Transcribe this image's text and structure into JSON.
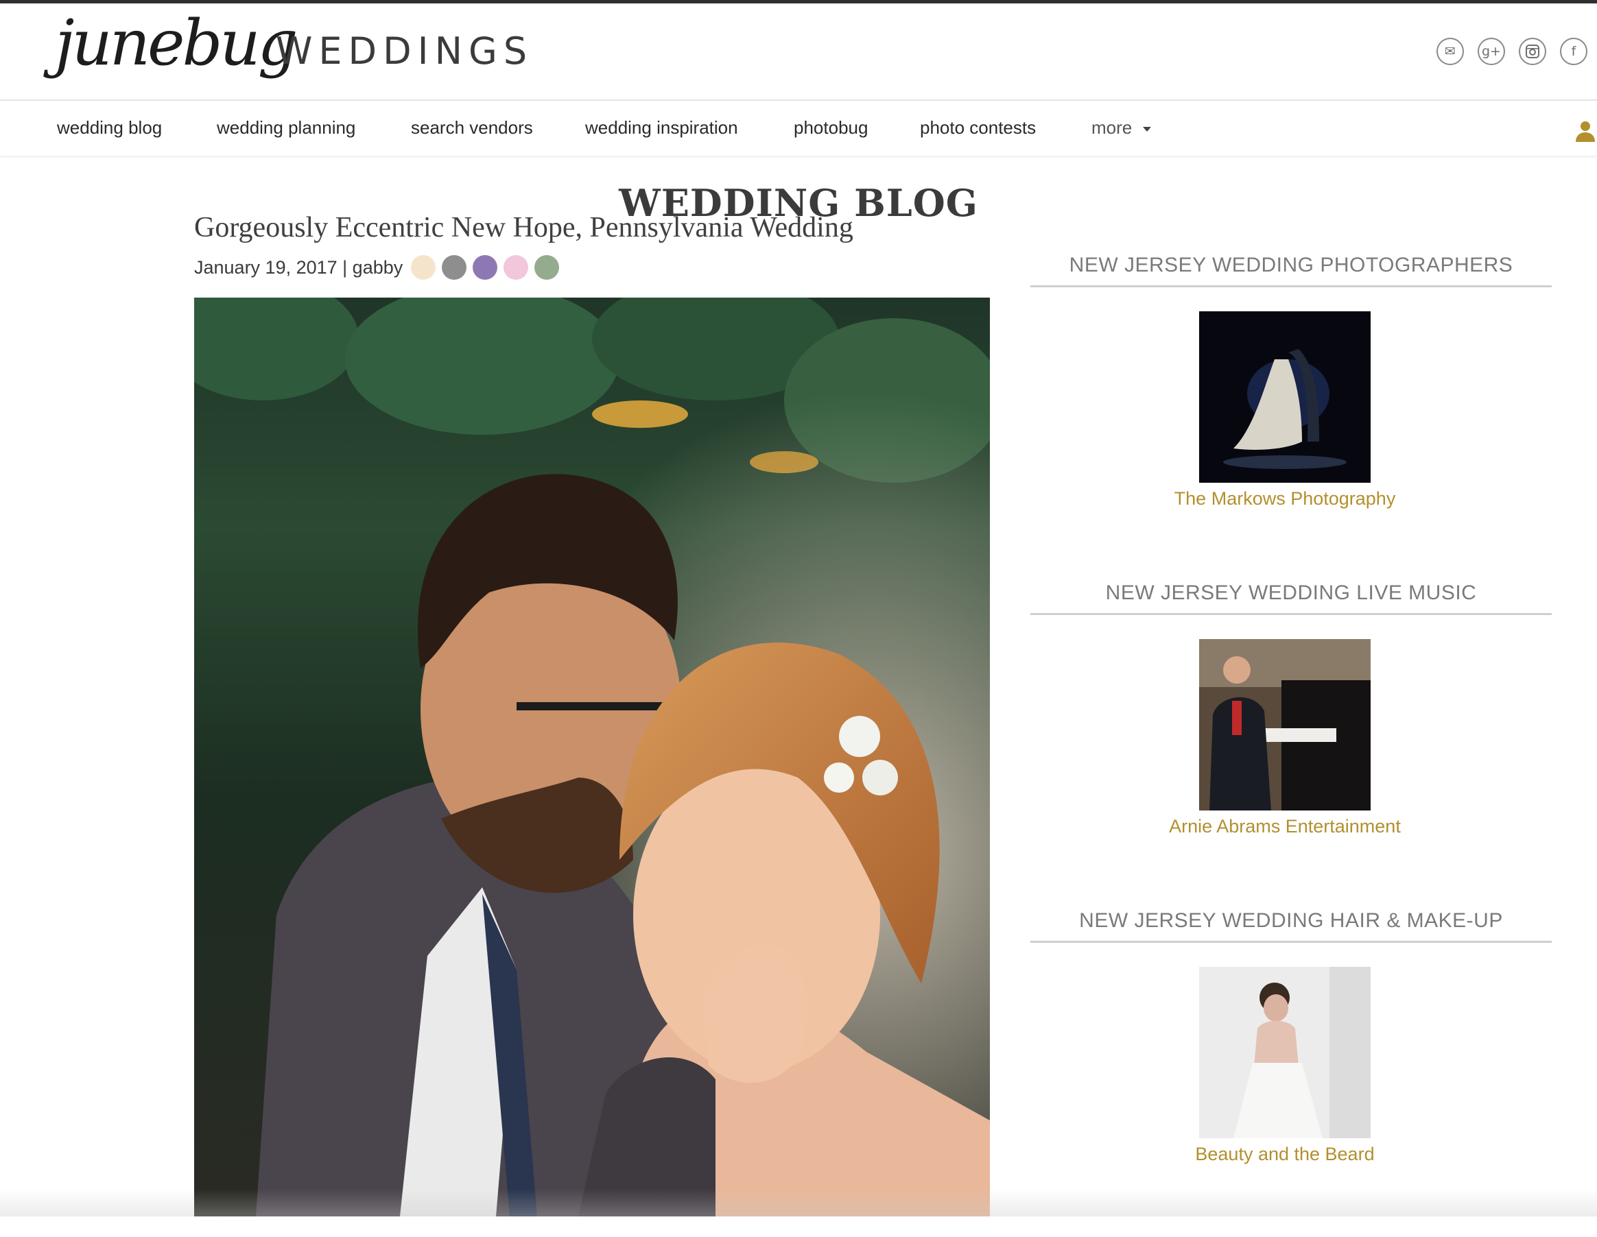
{
  "header": {
    "logo_script": "junebug",
    "logo_word": "WEDDINGS",
    "social": [
      {
        "name": "email-icon",
        "glyph": "✉"
      },
      {
        "name": "google-plus-icon",
        "glyph": "g+"
      },
      {
        "name": "instagram-icon",
        "glyph": "◙"
      },
      {
        "name": "facebook-icon",
        "glyph": "f"
      }
    ]
  },
  "nav": {
    "items": [
      "wedding blog",
      "wedding planning",
      "search vendors",
      "wedding inspiration",
      "photobug",
      "photo contests"
    ],
    "more_label": "more"
  },
  "page": {
    "title": "WEDDING BLOG"
  },
  "post": {
    "title": "Gorgeously Eccentric New Hope, Pennsylvania Wedding",
    "meta": "January 19, 2017 | gabby",
    "swatch_colors": [
      "#f5e4cc",
      "#8e8e8e",
      "#8d78b4",
      "#f2c6dc",
      "#95ab8d"
    ],
    "hero_image": "couple-portrait-photo"
  },
  "sidebar": {
    "sections": [
      {
        "heading": "NEW JERSEY WEDDING PHOTOGRAPHERS",
        "vendor": "The Markows Photography",
        "thumb": "night-couple-photo"
      },
      {
        "heading": "NEW JERSEY WEDDING LIVE MUSIC",
        "vendor": "Arnie Abrams Entertainment",
        "thumb": "pianist-photo"
      },
      {
        "heading": "NEW JERSEY WEDDING HAIR & MAKE-UP",
        "vendor": "Beauty and the Beard",
        "thumb": "bride-back-photo"
      }
    ]
  },
  "colors": {
    "accent_gold": "#b38f2e",
    "nav_text": "#2a2a2a",
    "heading_gray": "#7a7a7a"
  }
}
